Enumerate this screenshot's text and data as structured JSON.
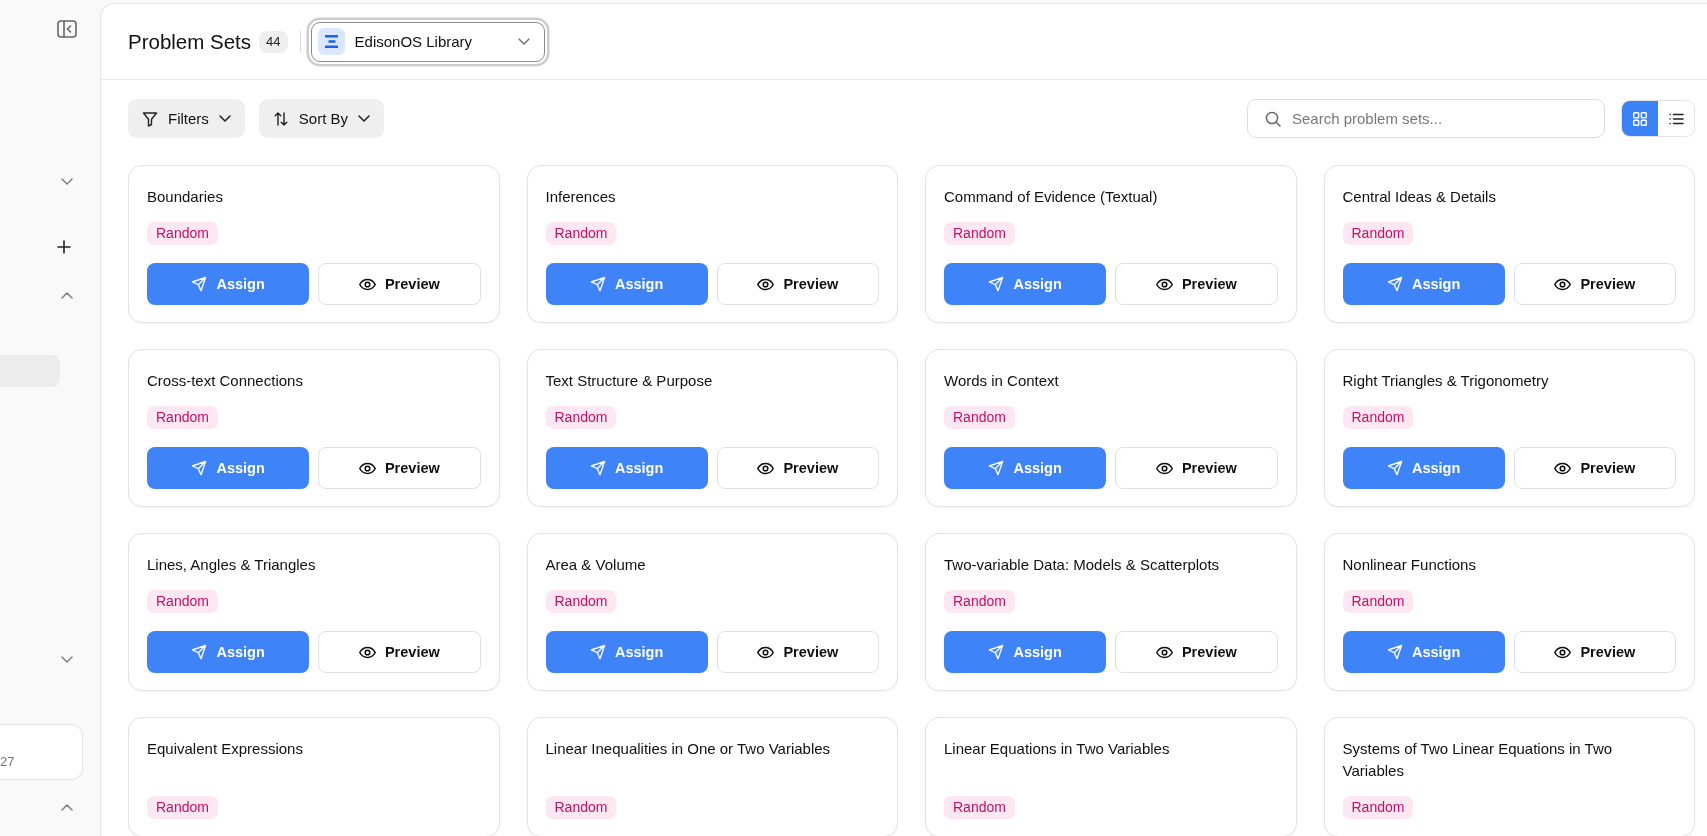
{
  "sidebar": {
    "top": [
      {
        "kind": "section",
        "expanded": false
      },
      {
        "kind": "add"
      },
      {
        "kind": "section",
        "expanded": true
      },
      {
        "kind": "item",
        "selected": true
      }
    ],
    "bottom": [
      {
        "kind": "section",
        "expanded": false
      },
      {
        "kind": "card",
        "text": "27"
      },
      {
        "kind": "section",
        "expanded": true
      }
    ]
  },
  "header": {
    "title": "Problem Sets",
    "count": "44",
    "library": {
      "label": "EdisonOS Library",
      "focused": true
    }
  },
  "toolbar": {
    "filters": "Filters",
    "sort": "Sort By",
    "search": {
      "placeholder": "Search problem sets..."
    },
    "views": [
      {
        "kind": "grid",
        "selected": true
      },
      {
        "kind": "list",
        "selected": false
      }
    ]
  },
  "cards": [
    {
      "title": "Boundaries",
      "tag": "Random",
      "actions": [
        {
          "kind": "assign",
          "label": "Assign"
        },
        {
          "kind": "preview",
          "label": "Preview"
        }
      ]
    },
    {
      "title": "Inferences",
      "tag": "Random",
      "actions": [
        {
          "kind": "assign",
          "label": "Assign"
        },
        {
          "kind": "preview",
          "label": "Preview"
        }
      ]
    },
    {
      "title": "Command of Evidence (Textual)",
      "tag": "Random",
      "actions": [
        {
          "kind": "assign",
          "label": "Assign"
        },
        {
          "kind": "preview",
          "label": "Preview"
        }
      ]
    },
    {
      "title": "Central Ideas & Details",
      "tag": "Random",
      "actions": [
        {
          "kind": "assign",
          "label": "Assign"
        },
        {
          "kind": "preview",
          "label": "Preview"
        }
      ]
    },
    {
      "title": "Cross-text Connections",
      "tag": "Random",
      "actions": [
        {
          "kind": "assign",
          "label": "Assign"
        },
        {
          "kind": "preview",
          "label": "Preview"
        }
      ]
    },
    {
      "title": "Text Structure & Purpose",
      "tag": "Random",
      "actions": [
        {
          "kind": "assign",
          "label": "Assign"
        },
        {
          "kind": "preview",
          "label": "Preview"
        }
      ]
    },
    {
      "title": "Words in Context",
      "tag": "Random",
      "actions": [
        {
          "kind": "assign",
          "label": "Assign"
        },
        {
          "kind": "preview",
          "label": "Preview"
        }
      ]
    },
    {
      "title": "Right Triangles & Trigonometry",
      "tag": "Random",
      "actions": [
        {
          "kind": "assign",
          "label": "Assign"
        },
        {
          "kind": "preview",
          "label": "Preview"
        }
      ]
    },
    {
      "title": "Lines, Angles & Triangles",
      "tag": "Random",
      "actions": [
        {
          "kind": "assign",
          "label": "Assign"
        },
        {
          "kind": "preview",
          "label": "Preview"
        }
      ]
    },
    {
      "title": "Area & Volume",
      "tag": "Random",
      "actions": [
        {
          "kind": "assign",
          "label": "Assign"
        },
        {
          "kind": "preview",
          "label": "Preview"
        }
      ]
    },
    {
      "title": "Two-variable Data: Models & Scatterplots",
      "tag": "Random",
      "actions": [
        {
          "kind": "assign",
          "label": "Assign"
        },
        {
          "kind": "preview",
          "label": "Preview"
        }
      ]
    },
    {
      "title": "Nonlinear Functions",
      "tag": "Random",
      "actions": [
        {
          "kind": "assign",
          "label": "Assign"
        },
        {
          "kind": "preview",
          "label": "Preview"
        }
      ]
    },
    {
      "title": "Equivalent Expressions",
      "tag": "Random"
    },
    {
      "title": "Linear Inequalities in One or Two Variables",
      "tag": "Random"
    },
    {
      "title": "Linear Equations in Two Variables",
      "tag": "Random"
    },
    {
      "title": "Systems of Two Linear Equations in Two Variables",
      "tag": "Random"
    }
  ]
}
